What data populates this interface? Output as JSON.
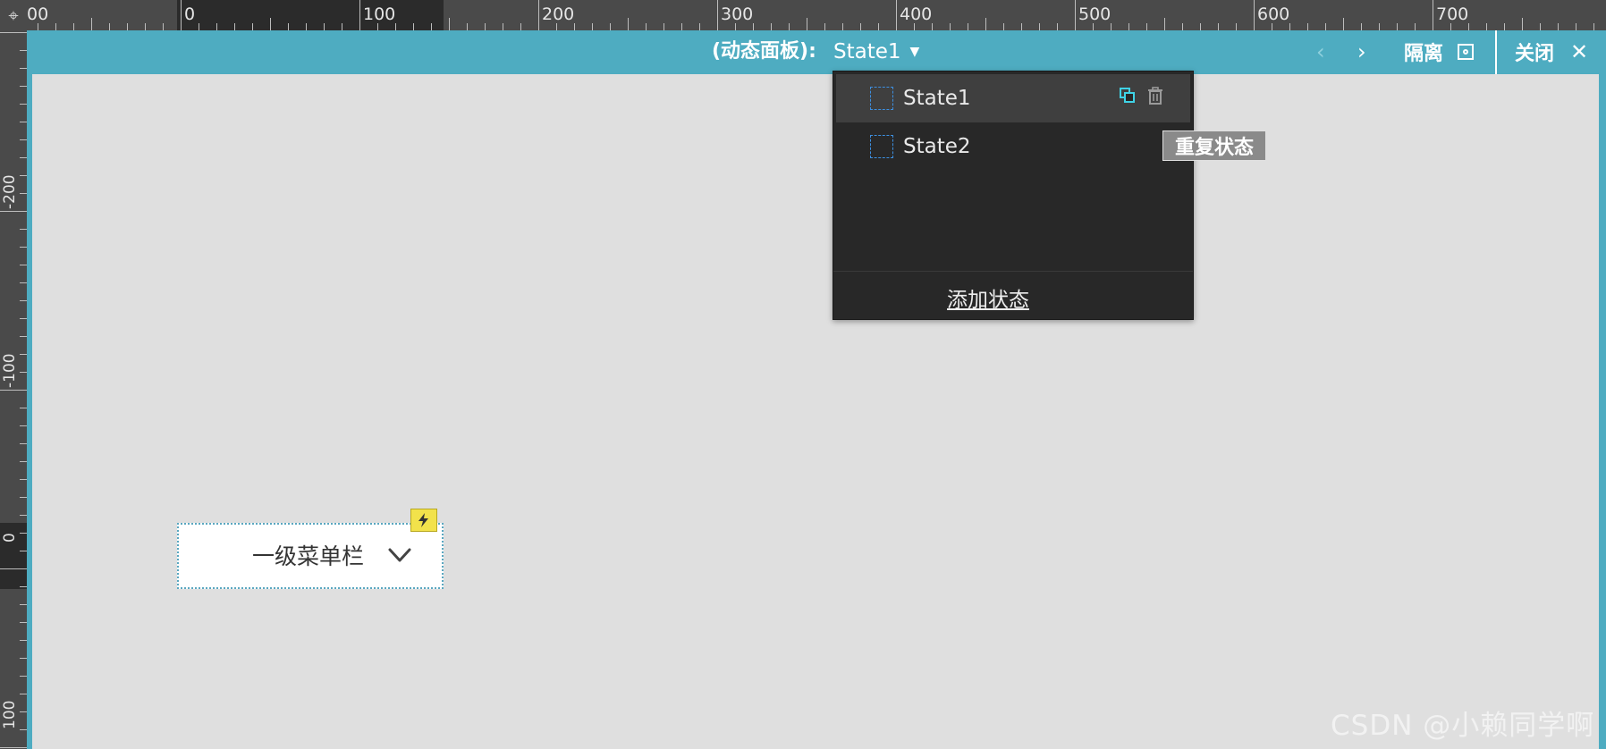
{
  "ruler": {
    "top_labels": [
      "00",
      "0",
      "100",
      "200",
      "300",
      "400",
      "500",
      "600",
      "700"
    ],
    "left_labels": [
      "-200",
      "-100",
      "0",
      "100"
    ]
  },
  "panel_bar": {
    "label": "(动态面板):",
    "current_state": "State1",
    "prev_icon": "chevron-left-icon",
    "next_icon": "chevron-right-icon",
    "isolate_label": "隔离",
    "isolate_icon": "isolate-icon",
    "close_label": "关闭",
    "close_icon": "close-icon"
  },
  "state_dropdown": {
    "states": [
      {
        "name": "State1",
        "active": true
      },
      {
        "name": "State2",
        "active": false
      }
    ],
    "duplicate_icon": "duplicate-icon",
    "delete_icon": "trash-icon",
    "add_state_label": "添加状态"
  },
  "tooltip": {
    "text": "重复状态"
  },
  "widget": {
    "label": "一级菜单栏",
    "chevron_icon": "chevron-down-icon",
    "badge_icon": "lightning-icon"
  },
  "watermark": "CSDN @小赖同学啊",
  "colors": {
    "accent": "#4eacc1",
    "dropdown_bg": "#282828",
    "badge": "#f2e24b",
    "duplicate_icon": "#3fd3e6"
  }
}
